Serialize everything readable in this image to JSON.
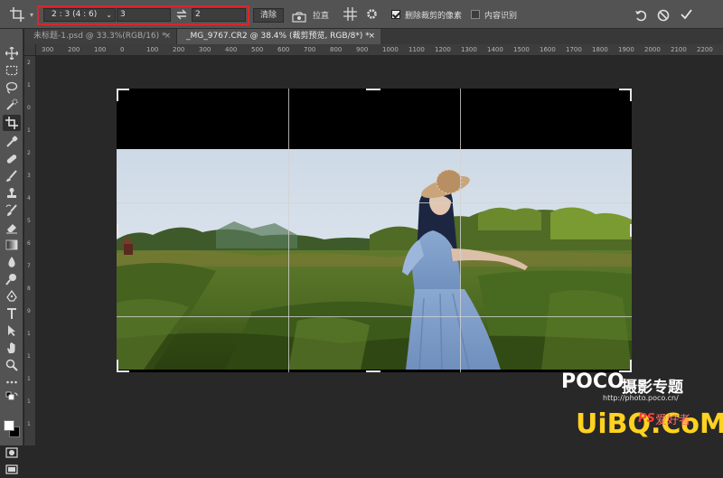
{
  "options_bar": {
    "ratio_value": "2 : 3 (4 : 6)",
    "width_value": "3",
    "height_value": "2",
    "clear_label": "清除",
    "straighten_label": "拉直",
    "delete_cropped_label": "删除裁剪的像素",
    "delete_cropped_checked": true,
    "content_aware_label": "内容识别",
    "content_aware_checked": false
  },
  "tabs": [
    {
      "label": "未标题-1.psd @ 33.3%(RGB/16) *",
      "close": "×",
      "active": false
    },
    {
      "label": "_MG_9767.CR2 @ 38.4% (裁剪预览, RGB/8*) *",
      "close": "×",
      "active": true
    }
  ],
  "ruler_top": [
    "300",
    "200",
    "100",
    "0",
    "100",
    "200",
    "300",
    "400",
    "500",
    "600",
    "700",
    "800",
    "900",
    "1000",
    "1100",
    "1200",
    "1300",
    "1400",
    "1500",
    "1600",
    "1700",
    "1800",
    "1900",
    "2000",
    "2100",
    "2200"
  ],
  "ruler_left": [
    "2",
    "1",
    "0",
    "1",
    "2",
    "3",
    "4",
    "5",
    "6",
    "7",
    "8",
    "9",
    "1",
    "1",
    "1",
    "1",
    "1"
  ],
  "watermarks": {
    "poco": "POCO",
    "poco_cn": "摄影专题",
    "poco_url": "http://photo.poco.cn/",
    "uibq": "UiBQ.CoM",
    "ps": "PS",
    "ps_cn": "爱好者"
  },
  "colors": {
    "panel": "#535353",
    "canvas": "#282828",
    "highlight": "#d8262d"
  }
}
